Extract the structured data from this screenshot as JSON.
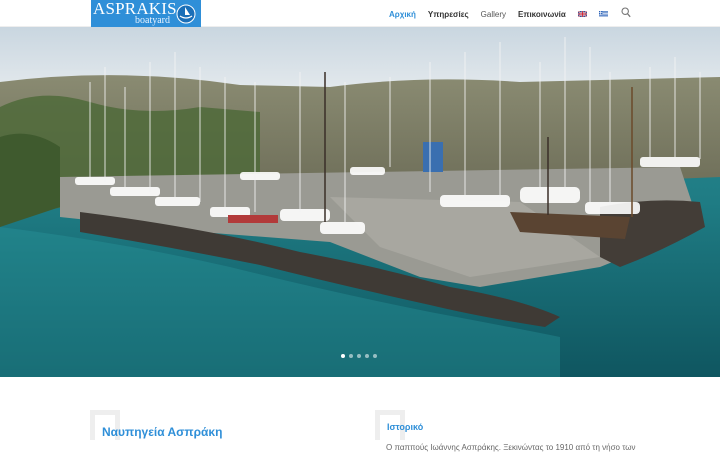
{
  "header": {
    "logo": {
      "brand": "ASPRAKIS",
      "tagline": "boatyard"
    },
    "nav": [
      {
        "label": "Αρχική",
        "active": true
      },
      {
        "label": "Υπηρεσίες",
        "active": false
      },
      {
        "label": "Gallery",
        "active": false
      },
      {
        "label": "Επικοινωνία",
        "active": false
      }
    ],
    "languages": [
      "english-flag-icon",
      "greek-flag-icon"
    ],
    "search_icon": "search-icon"
  },
  "hero": {
    "slide_count": 5,
    "active_slide": 1
  },
  "content": {
    "left_heading": "Ναυπηγεία Ασπράκη",
    "right_heading": "Ιστορικό",
    "right_text": "Ο παππούς Ιωάννης Ασπράκης. Ξεκινώντας το 1910 από τη νήσο των"
  },
  "colors": {
    "accent": "#2f8fd8",
    "nav_text": "#333333",
    "body_text": "#666666",
    "sea": "#1f7f88"
  }
}
